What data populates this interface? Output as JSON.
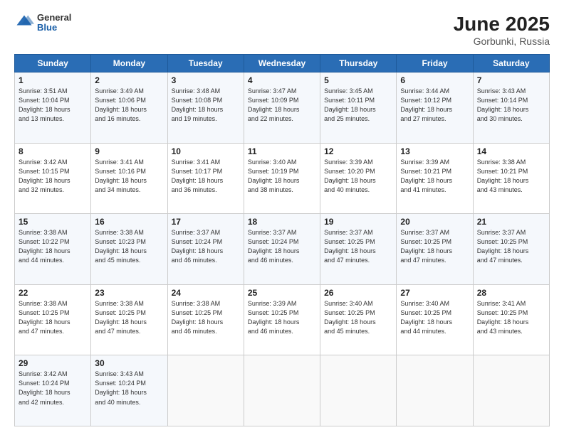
{
  "header": {
    "logo_general": "General",
    "logo_blue": "Blue",
    "title": "June 2025",
    "subtitle": "Gorbunki, Russia"
  },
  "days_of_week": [
    "Sunday",
    "Monday",
    "Tuesday",
    "Wednesday",
    "Thursday",
    "Friday",
    "Saturday"
  ],
  "weeks": [
    [
      {
        "day": "1",
        "info": "Sunrise: 3:51 AM\nSunset: 10:04 PM\nDaylight: 18 hours\nand 13 minutes."
      },
      {
        "day": "2",
        "info": "Sunrise: 3:49 AM\nSunset: 10:06 PM\nDaylight: 18 hours\nand 16 minutes."
      },
      {
        "day": "3",
        "info": "Sunrise: 3:48 AM\nSunset: 10:08 PM\nDaylight: 18 hours\nand 19 minutes."
      },
      {
        "day": "4",
        "info": "Sunrise: 3:47 AM\nSunset: 10:09 PM\nDaylight: 18 hours\nand 22 minutes."
      },
      {
        "day": "5",
        "info": "Sunrise: 3:45 AM\nSunset: 10:11 PM\nDaylight: 18 hours\nand 25 minutes."
      },
      {
        "day": "6",
        "info": "Sunrise: 3:44 AM\nSunset: 10:12 PM\nDaylight: 18 hours\nand 27 minutes."
      },
      {
        "day": "7",
        "info": "Sunrise: 3:43 AM\nSunset: 10:14 PM\nDaylight: 18 hours\nand 30 minutes."
      }
    ],
    [
      {
        "day": "8",
        "info": "Sunrise: 3:42 AM\nSunset: 10:15 PM\nDaylight: 18 hours\nand 32 minutes."
      },
      {
        "day": "9",
        "info": "Sunrise: 3:41 AM\nSunset: 10:16 PM\nDaylight: 18 hours\nand 34 minutes."
      },
      {
        "day": "10",
        "info": "Sunrise: 3:41 AM\nSunset: 10:17 PM\nDaylight: 18 hours\nand 36 minutes."
      },
      {
        "day": "11",
        "info": "Sunrise: 3:40 AM\nSunset: 10:19 PM\nDaylight: 18 hours\nand 38 minutes."
      },
      {
        "day": "12",
        "info": "Sunrise: 3:39 AM\nSunset: 10:20 PM\nDaylight: 18 hours\nand 40 minutes."
      },
      {
        "day": "13",
        "info": "Sunrise: 3:39 AM\nSunset: 10:21 PM\nDaylight: 18 hours\nand 41 minutes."
      },
      {
        "day": "14",
        "info": "Sunrise: 3:38 AM\nSunset: 10:21 PM\nDaylight: 18 hours\nand 43 minutes."
      }
    ],
    [
      {
        "day": "15",
        "info": "Sunrise: 3:38 AM\nSunset: 10:22 PM\nDaylight: 18 hours\nand 44 minutes."
      },
      {
        "day": "16",
        "info": "Sunrise: 3:38 AM\nSunset: 10:23 PM\nDaylight: 18 hours\nand 45 minutes."
      },
      {
        "day": "17",
        "info": "Sunrise: 3:37 AM\nSunset: 10:24 PM\nDaylight: 18 hours\nand 46 minutes."
      },
      {
        "day": "18",
        "info": "Sunrise: 3:37 AM\nSunset: 10:24 PM\nDaylight: 18 hours\nand 46 minutes."
      },
      {
        "day": "19",
        "info": "Sunrise: 3:37 AM\nSunset: 10:25 PM\nDaylight: 18 hours\nand 47 minutes."
      },
      {
        "day": "20",
        "info": "Sunrise: 3:37 AM\nSunset: 10:25 PM\nDaylight: 18 hours\nand 47 minutes."
      },
      {
        "day": "21",
        "info": "Sunrise: 3:37 AM\nSunset: 10:25 PM\nDaylight: 18 hours\nand 47 minutes."
      }
    ],
    [
      {
        "day": "22",
        "info": "Sunrise: 3:38 AM\nSunset: 10:25 PM\nDaylight: 18 hours\nand 47 minutes."
      },
      {
        "day": "23",
        "info": "Sunrise: 3:38 AM\nSunset: 10:25 PM\nDaylight: 18 hours\nand 47 minutes."
      },
      {
        "day": "24",
        "info": "Sunrise: 3:38 AM\nSunset: 10:25 PM\nDaylight: 18 hours\nand 46 minutes."
      },
      {
        "day": "25",
        "info": "Sunrise: 3:39 AM\nSunset: 10:25 PM\nDaylight: 18 hours\nand 46 minutes."
      },
      {
        "day": "26",
        "info": "Sunrise: 3:40 AM\nSunset: 10:25 PM\nDaylight: 18 hours\nand 45 minutes."
      },
      {
        "day": "27",
        "info": "Sunrise: 3:40 AM\nSunset: 10:25 PM\nDaylight: 18 hours\nand 44 minutes."
      },
      {
        "day": "28",
        "info": "Sunrise: 3:41 AM\nSunset: 10:25 PM\nDaylight: 18 hours\nand 43 minutes."
      }
    ],
    [
      {
        "day": "29",
        "info": "Sunrise: 3:42 AM\nSunset: 10:24 PM\nDaylight: 18 hours\nand 42 minutes."
      },
      {
        "day": "30",
        "info": "Sunrise: 3:43 AM\nSunset: 10:24 PM\nDaylight: 18 hours\nand 40 minutes."
      },
      {
        "day": "",
        "info": ""
      },
      {
        "day": "",
        "info": ""
      },
      {
        "day": "",
        "info": ""
      },
      {
        "day": "",
        "info": ""
      },
      {
        "day": "",
        "info": ""
      }
    ]
  ]
}
